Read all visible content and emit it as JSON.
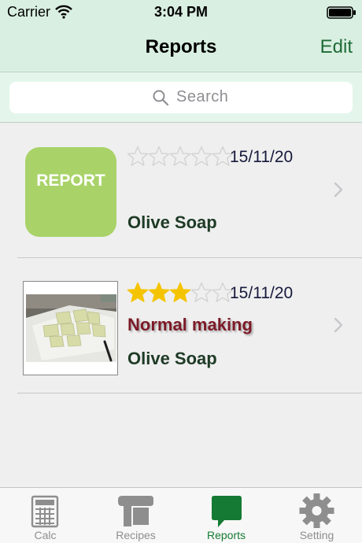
{
  "status_bar": {
    "carrier": "Carrier",
    "time": "3:04 PM"
  },
  "nav": {
    "title": "Reports",
    "edit_label": "Edit"
  },
  "search": {
    "placeholder": "Search"
  },
  "reports": [
    {
      "thumbnail_text": "REPORT",
      "rating": 0,
      "max_rating": 5,
      "date": "15/11/20",
      "subtitle": "",
      "name": "Olive Soap"
    },
    {
      "thumbnail": "soap-photo",
      "rating": 3,
      "max_rating": 5,
      "date": "15/11/20",
      "subtitle": "Normal making",
      "name": "Olive Soap"
    }
  ],
  "tabs": [
    {
      "label": "Calc",
      "icon": "calculator-icon",
      "active": false
    },
    {
      "label": "Recipes",
      "icon": "recipe-book-icon",
      "active": false
    },
    {
      "label": "Reports",
      "icon": "speech-bubble-icon",
      "active": true
    },
    {
      "label": "Setting",
      "icon": "gear-icon",
      "active": false
    }
  ],
  "colors": {
    "bar_background": "#d9efe1",
    "accent_green": "#1f6b37",
    "report_tile": "#a9d369",
    "star_gold": "#f5c400",
    "subtitle_red": "#7c1a27",
    "tab_active": "#157a33"
  }
}
